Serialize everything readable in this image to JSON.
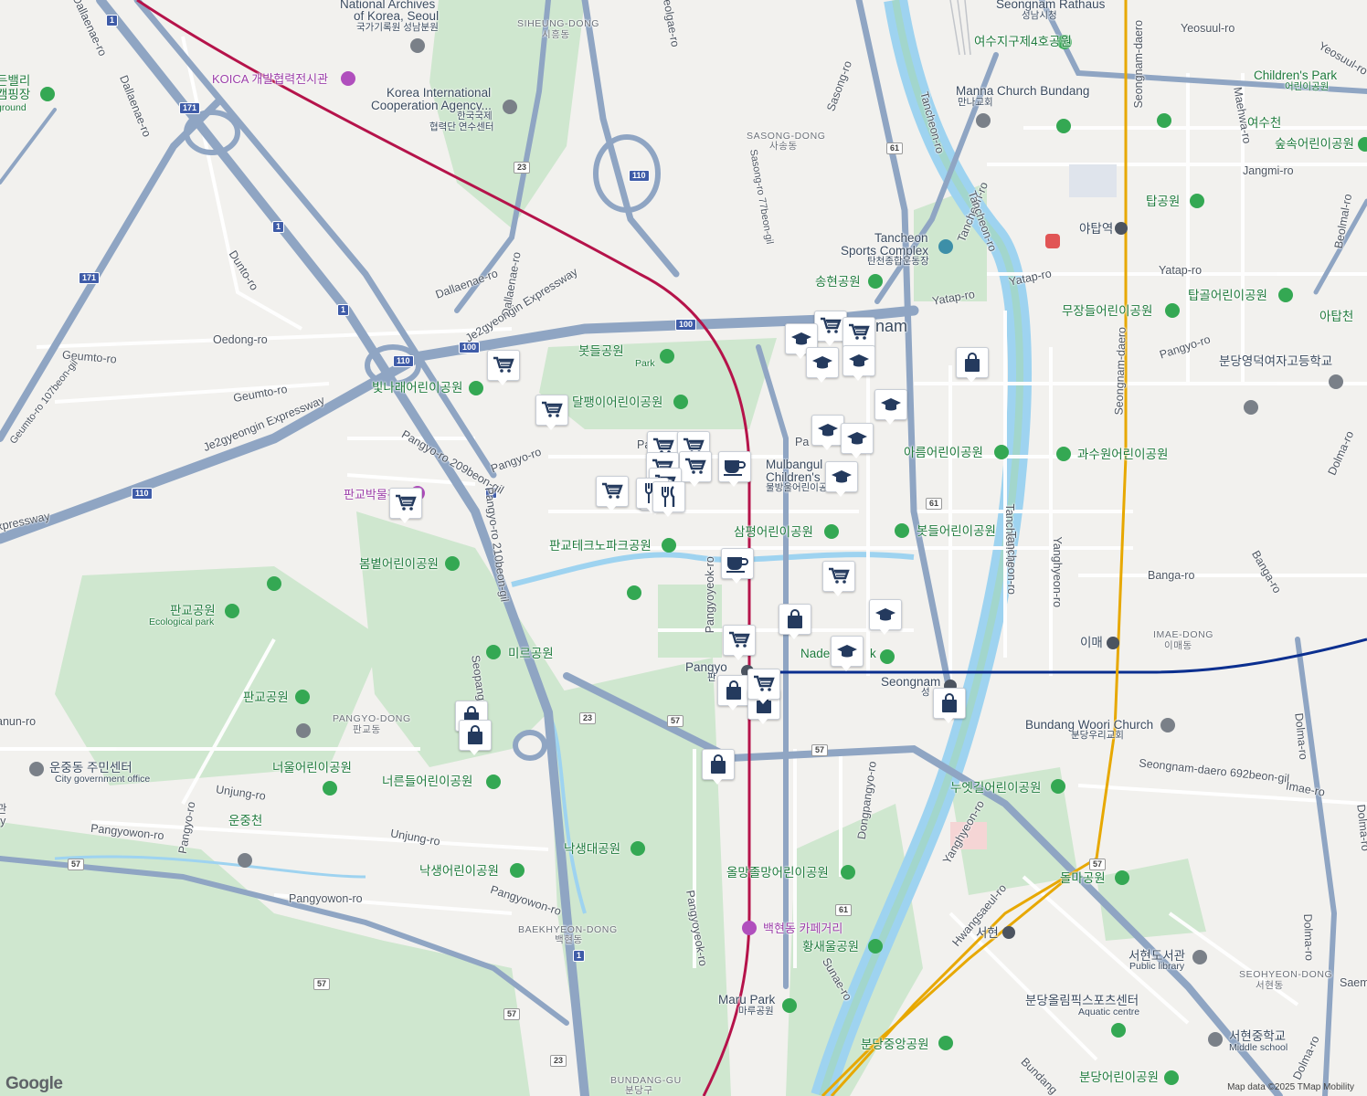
{
  "map": {
    "attribution": "Map data ©2025 TMap Mobility",
    "provider_logo": "Google",
    "colors": {
      "land": "#f2f1ee",
      "park": "#cfe7cf",
      "water": "#9ed3f0",
      "highway": "#8fa5c3",
      "rail_red": "#b5134a",
      "rail_blue": "#0b2f8f",
      "rail_yellow": "#e7a800"
    }
  },
  "labels": {
    "national_archives": "National Archives",
    "of_korea_seoul": "of Korea, Seoul",
    "national_archives_ko": "국가기록원 성남분원",
    "siheung_dong": "SIHEUNG-DONG",
    "siheung_dong_ko": "시흥동",
    "seongnam_rathaus": "Seongnam Rathaus",
    "seongnam_rathaus_ko": "성남시청",
    "yeosu_park4": "여수지구제4호공원",
    "yeosuul_ro": "Yeosuul-ro",
    "yeosuul_ro2": "Yeosuul-ro",
    "koica": "KOICA 개발협력전시관",
    "manna_church": "Manna Church Bundang",
    "manna_church_ko": "만나교회",
    "childrens_park": "Children's Park",
    "childrens_park_ko": "어린이공원",
    "koica_center": "Korea International",
    "koica_center2": "Cooperation Agency...",
    "koica_center_ko": "한국국제",
    "koica_center_ko2": "협력단 연수센터",
    "dallaenae_ro_top": "Dallaenae-ro",
    "dallaenae_ro_mid": "Dallaenae-ro",
    "dallaenae_ro_bot": "Dallaenae-ro",
    "seolgae_ro": "Seolgae-ro",
    "sasong_ro": "Sasong-ro",
    "sasong_dong": "SASONG-DONG",
    "sasong_dong_ko": "사송동",
    "sasong_ro_77": "Sasong-ro 77beon-gil",
    "tancheon_ro_a": "Tancheon-ro",
    "tancheon_ro_b": "Tancheon-ro",
    "tancheon_ro_c": "Tancheon-ro",
    "tancheon_ro_d": "Tancheon-ro",
    "seongnam_daero_v": "Seongnam-daero",
    "seongnam_daero_v2": "Seongnam-daero",
    "maehwa_ro": "Maehwa-ro",
    "yeosucheon": "여수천",
    "sooksok_park": "숲속어린이공원",
    "jangmi_ro": "Jangmi-ro",
    "tap_park": "탑공원",
    "yatap_station": "야탑역",
    "beolmal_ro": "Beolmal-ro",
    "tancheon_sports": "Tancheon",
    "tancheon_sports2": "Sports Complex",
    "tancheon_sports_ko": "탄천종합운동장",
    "yatap_ro_a": "Yatap-ro",
    "yatap_ro_b": "Yatap-ro",
    "yatap_ro_c": "Yatap-ro",
    "songhyeon_park": "송현공원",
    "tapgol_park": "탑골어린이공원",
    "mujangdeul_park": "무장들어린이공원",
    "atapcheon": "아탑천",
    "bundang_girls_high": "분당영덕여자고등학교",
    "pangyo_ro_right": "Pangyo-ro",
    "dunto_ro": "Dunto-ro",
    "dallaenae_ro_label": "Dallaenae-ro",
    "je2gyeongin_a": "Je2gyeongin Expressway",
    "je2gyeongin_b": "Je2gyeongin Expressway",
    "oedong_ro": "Oedong-ro",
    "geumto_ro_a": "Geumto-ro",
    "geumto_ro_b": "Geumto-ro",
    "geumto_107": "Geumto-ro 107beon-gil",
    "botdeul_park": "봇들공원",
    "botdeul_park_en": "Park",
    "binnarae_park": "빛나래어린이공원",
    "dalpaengi_park": "달팽이어린이공원",
    "pangyo_ro_209": "Pangyo-ro 209beon-gil",
    "pangyo_ro_main": "Pangyo-ro",
    "pangyo_museum": "판교박물관",
    "expressway_left": "xpressway",
    "mulbangul_park": "Mulbangul",
    "mulbangul_park2": "Children's",
    "mulbangul_park_ko": "물방울어린이공",
    "areum_park": "아름어린이공원",
    "gwasuwon_park": "과수원어린이공원",
    "dolma_ro_top": "Dolma-ro",
    "pangyo_ro_210": "Pangyo-ro 210beon-gil",
    "sampyeong_park": "삼평어린이공원",
    "botdeul_childpark": "봇들어린이공원",
    "tancheon_ro_e": "Tancheon-ro",
    "yanghyeon_ro": "Yanghyeon-ro",
    "bombit_park": "봄볕어린이공원",
    "pangyo_technopark": "판교테크노파크공원",
    "pangyoyeok_ro": "Pangyoyeok-ro",
    "banga_ro_a": "Banga-ro",
    "banga_ro_b": "Banga-ro",
    "pangyo_park": "판교공원",
    "pangyo_park_en": "Ecological park",
    "imae_dong": "IMAE-DONG",
    "imae_dong_ko": "이매동",
    "imae_station": "이매",
    "mireu_park": "미르공원",
    "seopangyo": "Seopangyo-ro",
    "pangyo_station": "Pangyo",
    "pangyo_station_ko": "판",
    "nadeul_park": "Nade",
    "nadeul_park2": "k",
    "seongnam_station": "Seongnam",
    "seongnam_station_ko": "성",
    "unun_ro": "anun-ro",
    "pangyo_park2": "판교공원",
    "pangyo_dong": "PANGYO-DONG",
    "pangyo_dong_ko": "판교동",
    "bundang_woori": "Bundang Woori Church",
    "bundang_woori_ko": "분당우리교회",
    "unjung_center": "운중동 주민센터",
    "unjung_center_en": "City government office",
    "neoul_park": "너울어린이공원",
    "neoreundeul_park": "너른들어린이공원",
    "seongnam_daero_692": "Seongnam-daero 692beon-gil",
    "dolma_ro_mid": "Dolma-ro",
    "imae_ro": "Imae-ro",
    "unjung_ro_a": "Unjung-ro",
    "unjung_ro_b": "Unjung-ro",
    "unjungcheon": "운중천",
    "nuetgil_park": "누엣길어린이공원",
    "dongpangyo_ro": "Dongpangyo-ro",
    "yanghyeon_ro2": "Yanghyeon-ro",
    "pangyowon_ro_a": "Pangyowon-ro",
    "pangyowon_ro_b": "Pangyowon-ro",
    "pangyowon_ro_c": "Pangyowon-ro",
    "pangyo_ro_left": "Pangyo-ro",
    "naksaengdae_park": "낙생대공원",
    "dolma_ro_right": "Dolma-ro",
    "naksaeng_park": "낙생어린이공원",
    "olmang_park": "올망졸망어린이공원",
    "dolma_park": "돌마공원",
    "hwangsaeul_ro": "Hwangsaeul-ro",
    "seohyeon_station": "서현",
    "dolma_ro_bot": "Dolma-ro",
    "saem": "Saem",
    "baekhyeon_dong": "BAEKHYEON-DONG",
    "baekhyeon_dong_ko": "백현동",
    "baekhyeon_cafe": "백현동 카페거리",
    "hwangsaeul_park": "황새울공원",
    "seohyeon_library": "서현도서관",
    "seohyeon_library_en": "Public library",
    "seohyeon_dong": "SEOHYEON-DONG",
    "seohyeon_dong_ko": "서현동",
    "sunae_ro": "Sunae-ro",
    "maru_park": "Maru Park",
    "maru_park_ko": "마루공원",
    "bundang_olympic": "분당올림픽스포츠센터",
    "bundang_olympic_en": "Aquatic centre",
    "seohyeon_middle": "서현중학교",
    "seohyeon_middle_en": "Middle school",
    "bundang_central_park": "분당중앙공원",
    "bundang_gu": "BUNDANG-GU",
    "bundang_gu_ko": "분당구",
    "bundang_ro": "Bundang",
    "bundang_olympic_park": "분당어린이공원",
    "seongnam_partial": "nam",
    "jeongdong_label": "l",
    "pangyo_ro_center": "Pa",
    "valley_top": "든밸리",
    "valley_camp": "캠핑장",
    "valley_en": "ground",
    "jeong_label": "관",
    "jeong_label2": "ry",
    "pangyoyeok_ro2": "Pangyoyeok-ro",
    "pangyoyeok_ro_upper": "Pangyoyeok-ro"
  },
  "route_shields": [
    "1",
    "171",
    "110",
    "23",
    "100",
    "61",
    "57"
  ]
}
